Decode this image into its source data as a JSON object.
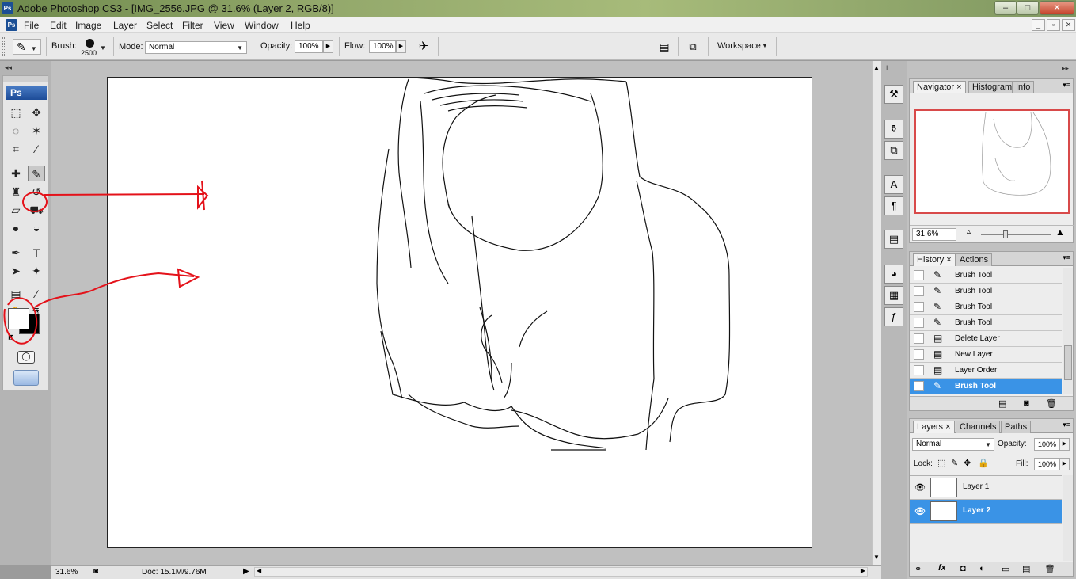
{
  "window": {
    "app_icon_label": "Ps",
    "title": "Adobe Photoshop CS3 - [IMG_2556.JPG @ 31.6% (Layer 2, RGB/8)]",
    "minimize": "‒",
    "maximize": "□",
    "close": "✕"
  },
  "menu": {
    "doc_icon_label": "Ps",
    "items": [
      "File",
      "Edit",
      "Image",
      "Layer",
      "Select",
      "Filter",
      "View",
      "Window",
      "Help"
    ],
    "doc_controls": [
      "_",
      "▫",
      "✕"
    ]
  },
  "options": {
    "brush_label": "Brush:",
    "brush_size": "2500",
    "mode_label": "Mode:",
    "mode_value": "Normal",
    "opacity_label": "Opacity:",
    "opacity_value": "100%",
    "flow_label": "Flow:",
    "flow_value": "100%",
    "workspace_label": "Workspace"
  },
  "toolbox": {
    "logo": "Ps",
    "tools": [
      {
        "name": "marquee-tool-icon",
        "glyph": "⬚"
      },
      {
        "name": "move-tool-icon",
        "glyph": "✥"
      },
      {
        "name": "lasso-tool-icon",
        "glyph": "◌"
      },
      {
        "name": "magic-wand-tool-icon",
        "glyph": "✶"
      },
      {
        "name": "crop-tool-icon",
        "glyph": "⌗"
      },
      {
        "name": "slice-tool-icon",
        "glyph": "⁄"
      },
      {
        "name": "healing-brush-tool-icon",
        "glyph": "✚"
      },
      {
        "name": "brush-tool-icon",
        "glyph": "✎"
      },
      {
        "name": "clone-stamp-tool-icon",
        "glyph": "♜"
      },
      {
        "name": "history-brush-tool-icon",
        "glyph": "↺"
      },
      {
        "name": "eraser-tool-icon",
        "glyph": "▱"
      },
      {
        "name": "paint-bucket-tool-icon",
        "glyph": "⛟"
      },
      {
        "name": "blur-tool-icon",
        "glyph": "●"
      },
      {
        "name": "dodge-tool-icon",
        "glyph": "◒"
      },
      {
        "name": "pen-tool-icon",
        "glyph": "✒"
      },
      {
        "name": "type-tool-icon",
        "glyph": "T"
      },
      {
        "name": "path-selection-tool-icon",
        "glyph": "➤"
      },
      {
        "name": "custom-shape-tool-icon",
        "glyph": "✦"
      },
      {
        "name": "notes-tool-icon",
        "glyph": "▤"
      },
      {
        "name": "eyedropper-tool-icon",
        "glyph": "⁄"
      },
      {
        "name": "hand-tool-icon",
        "glyph": "✋"
      },
      {
        "name": "zoom-tool-icon",
        "glyph": "⌕"
      }
    ]
  },
  "status": {
    "zoom": "31.6%",
    "doc_info": "Doc: 15.1M/9.76M"
  },
  "navigator": {
    "tabs": [
      "Navigator",
      "Histogram",
      "Info"
    ],
    "zoom": "31.6%"
  },
  "history": {
    "tabs": [
      "History",
      "Actions"
    ],
    "items": [
      {
        "icon": "brush-icon",
        "glyph": "✎",
        "label": "Brush Tool"
      },
      {
        "icon": "brush-icon",
        "glyph": "✎",
        "label": "Brush Tool"
      },
      {
        "icon": "brush-icon",
        "glyph": "✎",
        "label": "Brush Tool"
      },
      {
        "icon": "brush-icon",
        "glyph": "✎",
        "label": "Brush Tool"
      },
      {
        "icon": "layer-step-icon",
        "glyph": "▤",
        "label": "Delete Layer"
      },
      {
        "icon": "layer-step-icon",
        "glyph": "▤",
        "label": "New Layer"
      },
      {
        "icon": "layer-step-icon",
        "glyph": "▤",
        "label": "Layer Order"
      },
      {
        "icon": "brush-icon",
        "glyph": "✎",
        "label": "Brush Tool"
      }
    ],
    "active_index": 7
  },
  "layers": {
    "tabs": [
      "Layers",
      "Channels",
      "Paths"
    ],
    "blend_mode": "Normal",
    "opacity_label": "Opacity:",
    "opacity_value": "100%",
    "lock_label": "Lock:",
    "fill_label": "Fill:",
    "fill_value": "100%",
    "items": [
      {
        "name": "Layer 1",
        "visible": true
      },
      {
        "name": "Layer 2",
        "visible": true
      }
    ],
    "active_index": 1
  },
  "colors": {
    "annotation_red": "#e4121a",
    "selection_blue": "#3a93e6"
  }
}
